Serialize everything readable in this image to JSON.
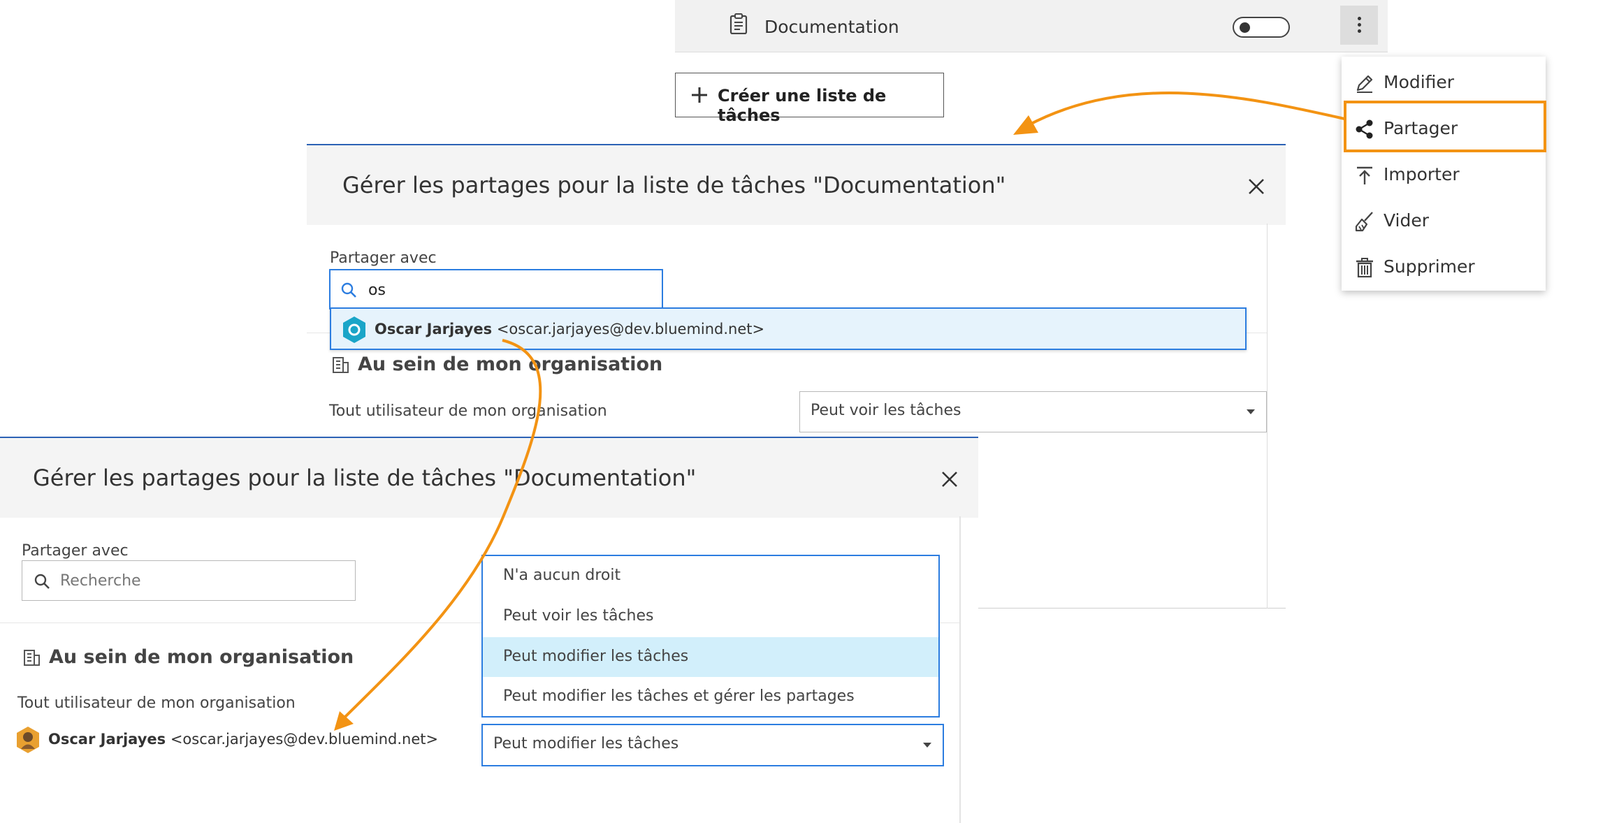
{
  "list_row": {
    "name": "Documentation"
  },
  "create_button": {
    "label": "Créer une liste de tâches"
  },
  "context_menu": {
    "items": [
      {
        "label": "Modifier",
        "icon": "pencil-icon"
      },
      {
        "label": "Partager",
        "icon": "share-icon"
      },
      {
        "label": "Importer",
        "icon": "upload-icon"
      },
      {
        "label": "Vider",
        "icon": "broom-icon"
      },
      {
        "label": "Supprimer",
        "icon": "trash-icon"
      }
    ],
    "highlighted": "Partager"
  },
  "dialog_top": {
    "title": "Gérer les partages pour la liste de tâches \"Documentation\"",
    "share_with_label": "Partager avec",
    "search_value": "os",
    "suggestion": {
      "name": "Oscar Jarjayes",
      "email": "<oscar.jarjayes@dev.bluemind.net>"
    },
    "section_title": "Au sein de mon organisation",
    "org_row_label": "Tout utilisateur de mon organisation",
    "org_row_value": "Peut voir les tâches"
  },
  "dialog_bottom": {
    "title": "Gérer les partages pour la liste de tâches \"Documentation\"",
    "share_with_label": "Partager avec",
    "search_placeholder": "Recherche",
    "section_title": "Au sein de mon organisation",
    "org_row_label": "Tout utilisateur de mon organisation",
    "dropdown_options": [
      "N'a aucun droit",
      "Peut voir les tâches",
      "Peut modifier les tâches",
      "Peut modifier les tâches et gérer les partages"
    ],
    "dropdown_active_index": 2,
    "user_row": {
      "name": "Oscar Jarjayes",
      "email": "<oscar.jarjayes@dev.bluemind.net>",
      "value": "Peut modifier les tâches"
    }
  },
  "colors": {
    "accent_blue": "#2c7de0",
    "highlight_orange": "#f39313",
    "selected_option": "#d2effb",
    "header_bg": "#f4f4f4"
  }
}
